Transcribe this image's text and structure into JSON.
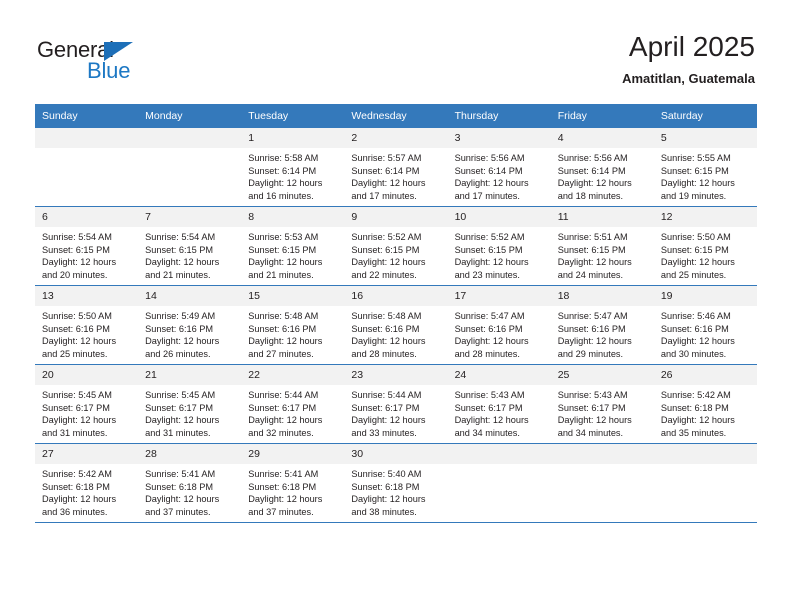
{
  "brand": {
    "name_part1": "General",
    "name_part2": "Blue",
    "triangle_color": "#1d6fb8",
    "blue_color": "#1d78c4"
  },
  "header": {
    "title": "April 2025",
    "subtitle": "Amatitlan, Guatemala"
  },
  "theme": {
    "header_row_bg": "#3479bb",
    "daynum_bg": "#f2f2f2",
    "row_border": "#3479bb",
    "text": "#231f20"
  },
  "weekday_headers": [
    "Sunday",
    "Monday",
    "Tuesday",
    "Wednesday",
    "Thursday",
    "Friday",
    "Saturday"
  ],
  "labels": {
    "sunrise_prefix": "Sunrise:",
    "sunset_prefix": "Sunset:",
    "daylight_prefix": "Daylight:"
  },
  "weeks": [
    [
      {
        "day": "",
        "line1": "",
        "line2": "",
        "line3": "",
        "line4": ""
      },
      {
        "day": "",
        "line1": "",
        "line2": "",
        "line3": "",
        "line4": ""
      },
      {
        "day": "1",
        "line1": "Sunrise: 5:58 AM",
        "line2": "Sunset: 6:14 PM",
        "line3": "Daylight: 12 hours",
        "line4": "and 16 minutes."
      },
      {
        "day": "2",
        "line1": "Sunrise: 5:57 AM",
        "line2": "Sunset: 6:14 PM",
        "line3": "Daylight: 12 hours",
        "line4": "and 17 minutes."
      },
      {
        "day": "3",
        "line1": "Sunrise: 5:56 AM",
        "line2": "Sunset: 6:14 PM",
        "line3": "Daylight: 12 hours",
        "line4": "and 17 minutes."
      },
      {
        "day": "4",
        "line1": "Sunrise: 5:56 AM",
        "line2": "Sunset: 6:14 PM",
        "line3": "Daylight: 12 hours",
        "line4": "and 18 minutes."
      },
      {
        "day": "5",
        "line1": "Sunrise: 5:55 AM",
        "line2": "Sunset: 6:15 PM",
        "line3": "Daylight: 12 hours",
        "line4": "and 19 minutes."
      }
    ],
    [
      {
        "day": "6",
        "line1": "Sunrise: 5:54 AM",
        "line2": "Sunset: 6:15 PM",
        "line3": "Daylight: 12 hours",
        "line4": "and 20 minutes."
      },
      {
        "day": "7",
        "line1": "Sunrise: 5:54 AM",
        "line2": "Sunset: 6:15 PM",
        "line3": "Daylight: 12 hours",
        "line4": "and 21 minutes."
      },
      {
        "day": "8",
        "line1": "Sunrise: 5:53 AM",
        "line2": "Sunset: 6:15 PM",
        "line3": "Daylight: 12 hours",
        "line4": "and 21 minutes."
      },
      {
        "day": "9",
        "line1": "Sunrise: 5:52 AM",
        "line2": "Sunset: 6:15 PM",
        "line3": "Daylight: 12 hours",
        "line4": "and 22 minutes."
      },
      {
        "day": "10",
        "line1": "Sunrise: 5:52 AM",
        "line2": "Sunset: 6:15 PM",
        "line3": "Daylight: 12 hours",
        "line4": "and 23 minutes."
      },
      {
        "day": "11",
        "line1": "Sunrise: 5:51 AM",
        "line2": "Sunset: 6:15 PM",
        "line3": "Daylight: 12 hours",
        "line4": "and 24 minutes."
      },
      {
        "day": "12",
        "line1": "Sunrise: 5:50 AM",
        "line2": "Sunset: 6:15 PM",
        "line3": "Daylight: 12 hours",
        "line4": "and 25 minutes."
      }
    ],
    [
      {
        "day": "13",
        "line1": "Sunrise: 5:50 AM",
        "line2": "Sunset: 6:16 PM",
        "line3": "Daylight: 12 hours",
        "line4": "and 25 minutes."
      },
      {
        "day": "14",
        "line1": "Sunrise: 5:49 AM",
        "line2": "Sunset: 6:16 PM",
        "line3": "Daylight: 12 hours",
        "line4": "and 26 minutes."
      },
      {
        "day": "15",
        "line1": "Sunrise: 5:48 AM",
        "line2": "Sunset: 6:16 PM",
        "line3": "Daylight: 12 hours",
        "line4": "and 27 minutes."
      },
      {
        "day": "16",
        "line1": "Sunrise: 5:48 AM",
        "line2": "Sunset: 6:16 PM",
        "line3": "Daylight: 12 hours",
        "line4": "and 28 minutes."
      },
      {
        "day": "17",
        "line1": "Sunrise: 5:47 AM",
        "line2": "Sunset: 6:16 PM",
        "line3": "Daylight: 12 hours",
        "line4": "and 28 minutes."
      },
      {
        "day": "18",
        "line1": "Sunrise: 5:47 AM",
        "line2": "Sunset: 6:16 PM",
        "line3": "Daylight: 12 hours",
        "line4": "and 29 minutes."
      },
      {
        "day": "19",
        "line1": "Sunrise: 5:46 AM",
        "line2": "Sunset: 6:16 PM",
        "line3": "Daylight: 12 hours",
        "line4": "and 30 minutes."
      }
    ],
    [
      {
        "day": "20",
        "line1": "Sunrise: 5:45 AM",
        "line2": "Sunset: 6:17 PM",
        "line3": "Daylight: 12 hours",
        "line4": "and 31 minutes."
      },
      {
        "day": "21",
        "line1": "Sunrise: 5:45 AM",
        "line2": "Sunset: 6:17 PM",
        "line3": "Daylight: 12 hours",
        "line4": "and 31 minutes."
      },
      {
        "day": "22",
        "line1": "Sunrise: 5:44 AM",
        "line2": "Sunset: 6:17 PM",
        "line3": "Daylight: 12 hours",
        "line4": "and 32 minutes."
      },
      {
        "day": "23",
        "line1": "Sunrise: 5:44 AM",
        "line2": "Sunset: 6:17 PM",
        "line3": "Daylight: 12 hours",
        "line4": "and 33 minutes."
      },
      {
        "day": "24",
        "line1": "Sunrise: 5:43 AM",
        "line2": "Sunset: 6:17 PM",
        "line3": "Daylight: 12 hours",
        "line4": "and 34 minutes."
      },
      {
        "day": "25",
        "line1": "Sunrise: 5:43 AM",
        "line2": "Sunset: 6:17 PM",
        "line3": "Daylight: 12 hours",
        "line4": "and 34 minutes."
      },
      {
        "day": "26",
        "line1": "Sunrise: 5:42 AM",
        "line2": "Sunset: 6:18 PM",
        "line3": "Daylight: 12 hours",
        "line4": "and 35 minutes."
      }
    ],
    [
      {
        "day": "27",
        "line1": "Sunrise: 5:42 AM",
        "line2": "Sunset: 6:18 PM",
        "line3": "Daylight: 12 hours",
        "line4": "and 36 minutes."
      },
      {
        "day": "28",
        "line1": "Sunrise: 5:41 AM",
        "line2": "Sunset: 6:18 PM",
        "line3": "Daylight: 12 hours",
        "line4": "and 37 minutes."
      },
      {
        "day": "29",
        "line1": "Sunrise: 5:41 AM",
        "line2": "Sunset: 6:18 PM",
        "line3": "Daylight: 12 hours",
        "line4": "and 37 minutes."
      },
      {
        "day": "30",
        "line1": "Sunrise: 5:40 AM",
        "line2": "Sunset: 6:18 PM",
        "line3": "Daylight: 12 hours",
        "line4": "and 38 minutes."
      },
      {
        "day": "",
        "line1": "",
        "line2": "",
        "line3": "",
        "line4": ""
      },
      {
        "day": "",
        "line1": "",
        "line2": "",
        "line3": "",
        "line4": ""
      },
      {
        "day": "",
        "line1": "",
        "line2": "",
        "line3": "",
        "line4": ""
      }
    ]
  ]
}
